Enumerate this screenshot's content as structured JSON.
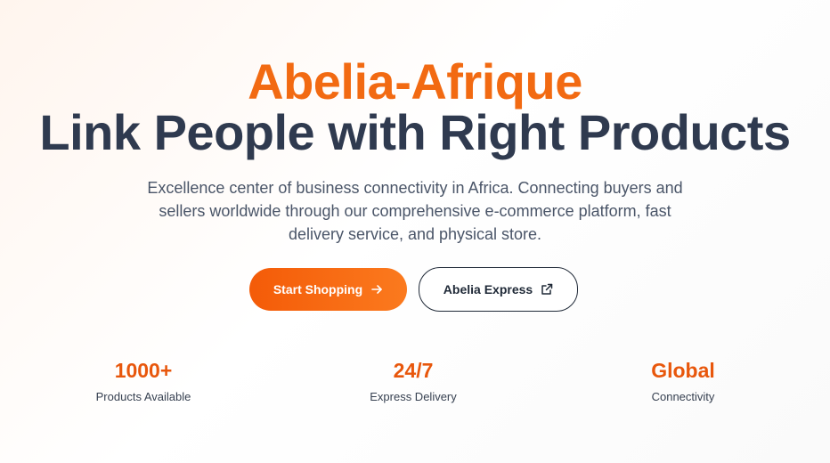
{
  "hero": {
    "brand": "Abelia-Afrique",
    "headline": "Link People with Right Products",
    "description": "Excellence center of business connectivity in Africa. Connecting buyers and sellers worldwide through our comprehensive e-commerce platform, fast delivery service, and physical store."
  },
  "buttons": {
    "primary": {
      "label": "Start Shopping",
      "icon": "arrow-right-icon"
    },
    "secondary": {
      "label": "Abelia Express",
      "icon": "external-link-icon"
    }
  },
  "stats": [
    {
      "value": "1000+",
      "label": "Products Available"
    },
    {
      "value": "24/7",
      "label": "Express Delivery"
    },
    {
      "value": "Global",
      "label": "Connectivity"
    }
  ],
  "colors": {
    "brand_orange": "#f26a12",
    "headline_navy": "#2f3a4f",
    "stat_orange": "#e8570c"
  }
}
